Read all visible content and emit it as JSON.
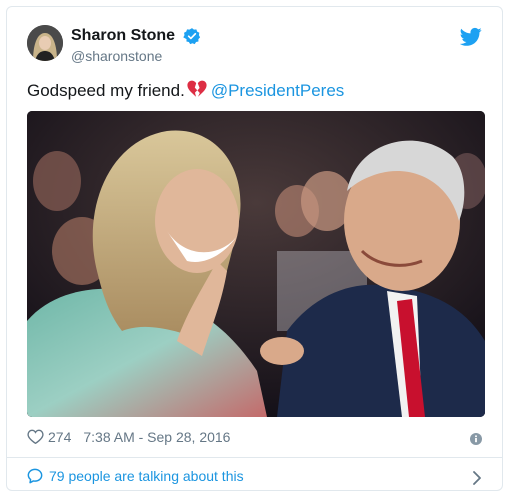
{
  "tweet": {
    "author": {
      "display_name": "Sharon Stone",
      "handle": "@sharonstone",
      "verified": true,
      "avatar_icon": "user-avatar-photo"
    },
    "text": "Godspeed my friend.",
    "emoji": "broken-heart",
    "mention": "@PresidentPeres",
    "photo_description": "Two people laughing and smiling at each other in a crowd",
    "likes": "274",
    "timestamp": "7:38 AM - Sep 28, 2016",
    "talking_text": "79 people are talking about this"
  },
  "icons": {
    "bird": "twitter-bird-icon",
    "verified": "verified-badge-icon",
    "like": "heart-outline-icon",
    "info": "info-icon",
    "bubble": "speech-bubble-icon",
    "chevron": "chevron-right-icon"
  },
  "colors": {
    "brand": "#1da1f2",
    "link": "#1b95e0",
    "muted": "#657786",
    "border": "#e1e8ed",
    "broken_heart": "#dd2e44"
  }
}
